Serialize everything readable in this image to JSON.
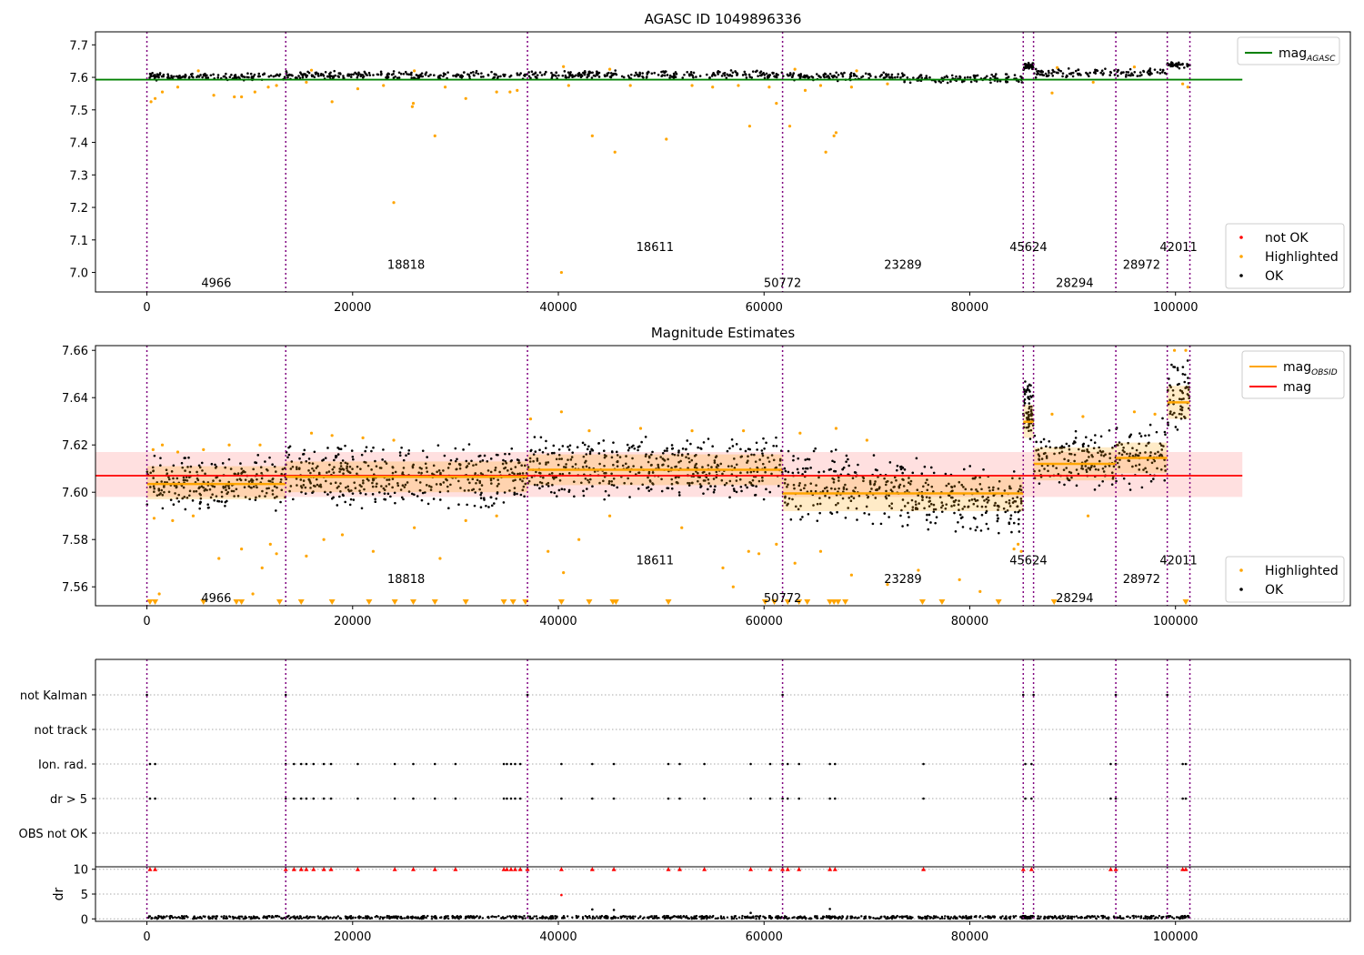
{
  "chart_data": [
    {
      "type": "scatter",
      "title": "AGASC ID 1049896336",
      "xlim": [
        -5000,
        117000
      ],
      "ylim": [
        6.94,
        7.74
      ],
      "x_ticks": [
        0,
        20000,
        40000,
        60000,
        80000,
        100000
      ],
      "y_ticks": [
        7.0,
        7.1,
        7.2,
        7.3,
        7.4,
        7.5,
        7.6,
        7.7
      ],
      "grid": false,
      "obsid_boundaries": [
        0,
        13500,
        37000,
        61800,
        85200,
        86200,
        94200,
        99200,
        101400
      ],
      "obsid_labels": [
        {
          "text": "4966",
          "x": 6750,
          "y": 6.97
        },
        {
          "text": "18818",
          "x": 25200,
          "y": 7.025
        },
        {
          "text": "18611",
          "x": 49400,
          "y": 7.08
        },
        {
          "text": "50772",
          "x": 61800,
          "y": 6.97
        },
        {
          "text": "23289",
          "x": 73500,
          "y": 7.025
        },
        {
          "text": "45624",
          "x": 85700,
          "y": 7.08
        },
        {
          "text": "28294",
          "x": 90200,
          "y": 6.97
        },
        {
          "text": "28972",
          "x": 96700,
          "y": 7.025
        },
        {
          "text": "42011",
          "x": 100300,
          "y": 7.08
        }
      ],
      "mag_agasc": 7.593,
      "mag_agasc_range": [
        -5000,
        106500
      ],
      "segments_ok": [
        {
          "x0": 0,
          "x1": 13500,
          "lo": 7.59,
          "hi": 7.615
        },
        {
          "x0": 13500,
          "x1": 37000,
          "lo": 7.592,
          "hi": 7.62
        },
        {
          "x0": 37000,
          "x1": 61800,
          "lo": 7.595,
          "hi": 7.622
        },
        {
          "x0": 61800,
          "x1": 73500,
          "lo": 7.588,
          "hi": 7.618
        },
        {
          "x0": 73500,
          "x1": 85200,
          "lo": 7.58,
          "hi": 7.612
        },
        {
          "x0": 85200,
          "x1": 86200,
          "lo": 7.62,
          "hi": 7.648
        },
        {
          "x0": 86200,
          "x1": 94200,
          "lo": 7.598,
          "hi": 7.628
        },
        {
          "x0": 94200,
          "x1": 99200,
          "lo": 7.6,
          "hi": 7.63
        },
        {
          "x0": 99200,
          "x1": 101400,
          "lo": 7.625,
          "hi": 7.65
        }
      ],
      "highlighted_points": [
        {
          "x": 400,
          "y": 7.525
        },
        {
          "x": 800,
          "y": 7.535
        },
        {
          "x": 1500,
          "y": 7.555
        },
        {
          "x": 3000,
          "y": 7.57
        },
        {
          "x": 6500,
          "y": 7.545
        },
        {
          "x": 8500,
          "y": 7.54
        },
        {
          "x": 9200,
          "y": 7.54
        },
        {
          "x": 10500,
          "y": 7.555
        },
        {
          "x": 11800,
          "y": 7.57
        },
        {
          "x": 12600,
          "y": 7.575
        },
        {
          "x": 15500,
          "y": 7.585
        },
        {
          "x": 18000,
          "y": 7.525
        },
        {
          "x": 20500,
          "y": 7.565
        },
        {
          "x": 23000,
          "y": 7.575
        },
        {
          "x": 24000,
          "y": 7.215
        },
        {
          "x": 25800,
          "y": 7.51
        },
        {
          "x": 25900,
          "y": 7.52
        },
        {
          "x": 28000,
          "y": 7.42
        },
        {
          "x": 29000,
          "y": 7.57
        },
        {
          "x": 31000,
          "y": 7.535
        },
        {
          "x": 34000,
          "y": 7.555
        },
        {
          "x": 35300,
          "y": 7.555
        },
        {
          "x": 36000,
          "y": 7.56
        },
        {
          "x": 40300,
          "y": 7.0
        },
        {
          "x": 41000,
          "y": 7.575
        },
        {
          "x": 43300,
          "y": 7.42
        },
        {
          "x": 45500,
          "y": 7.37
        },
        {
          "x": 47000,
          "y": 7.575
        },
        {
          "x": 50500,
          "y": 7.41
        },
        {
          "x": 53000,
          "y": 7.575
        },
        {
          "x": 55000,
          "y": 7.57
        },
        {
          "x": 57500,
          "y": 7.575
        },
        {
          "x": 58600,
          "y": 7.45
        },
        {
          "x": 60500,
          "y": 7.57
        },
        {
          "x": 61200,
          "y": 7.52
        },
        {
          "x": 62500,
          "y": 7.45
        },
        {
          "x": 64000,
          "y": 7.56
        },
        {
          "x": 65500,
          "y": 7.575
        },
        {
          "x": 66000,
          "y": 7.37
        },
        {
          "x": 66800,
          "y": 7.42
        },
        {
          "x": 67000,
          "y": 7.43
        },
        {
          "x": 68500,
          "y": 7.57
        },
        {
          "x": 72000,
          "y": 7.58
        },
        {
          "x": 88000,
          "y": 7.552
        },
        {
          "x": 92000,
          "y": 7.585
        },
        {
          "x": 100700,
          "y": 7.58
        },
        {
          "x": 101200,
          "y": 7.57
        },
        {
          "x": 5000,
          "y": 7.62
        },
        {
          "x": 16000,
          "y": 7.622
        },
        {
          "x": 26000,
          "y": 7.62
        },
        {
          "x": 40500,
          "y": 7.633
        },
        {
          "x": 45000,
          "y": 7.625
        },
        {
          "x": 63000,
          "y": 7.625
        },
        {
          "x": 69000,
          "y": 7.62
        },
        {
          "x": 88500,
          "y": 7.63
        },
        {
          "x": 96000,
          "y": 7.632
        }
      ],
      "legend_lines": [
        {
          "label": "mag",
          "subscript": "AGASC",
          "color": "#008000"
        }
      ],
      "legend_points": [
        {
          "label": "not OK",
          "color": "#ff0000"
        },
        {
          "label": "Highlighted",
          "color": "#ffa500"
        },
        {
          "label": "OK",
          "color": "#000000"
        }
      ]
    },
    {
      "type": "scatter",
      "title": "Magnitude Estimates",
      "xlim": [
        -5000,
        117000
      ],
      "ylim": [
        7.552,
        7.662
      ],
      "x_ticks": [
        0,
        20000,
        40000,
        60000,
        80000,
        100000
      ],
      "y_ticks": [
        7.56,
        7.58,
        7.6,
        7.62,
        7.64,
        7.66
      ],
      "grid": false,
      "obsid_boundaries": [
        0,
        13500,
        37000,
        61800,
        85200,
        86200,
        94200,
        99200,
        101400
      ],
      "obsid_labels": [
        {
          "text": "4966",
          "x": 6750,
          "y": 7.5555
        },
        {
          "text": "18818",
          "x": 25200,
          "y": 7.5635
        },
        {
          "text": "18611",
          "x": 49400,
          "y": 7.5715
        },
        {
          "text": "50772",
          "x": 61800,
          "y": 7.5555
        },
        {
          "text": "23289",
          "x": 73500,
          "y": 7.5635
        },
        {
          "text": "45624",
          "x": 85700,
          "y": 7.5715
        },
        {
          "text": "28294",
          "x": 90200,
          "y": 7.5555
        },
        {
          "text": "28972",
          "x": 96700,
          "y": 7.5635
        },
        {
          "text": "42011",
          "x": 100300,
          "y": 7.5715
        }
      ],
      "mag": 7.607,
      "mag_band": [
        7.598,
        7.617
      ],
      "mag_range": [
        -5000,
        106500
      ],
      "obsid_mags": [
        {
          "x0": 0,
          "x1": 13500,
          "mag": 7.6035,
          "lo": 7.597,
          "hi": 7.611
        },
        {
          "x0": 13500,
          "x1": 37000,
          "mag": 7.6065,
          "lo": 7.6,
          "hi": 7.613
        },
        {
          "x0": 37000,
          "x1": 61800,
          "mag": 7.6095,
          "lo": 7.603,
          "hi": 7.616
        },
        {
          "x0": 61800,
          "x1": 85200,
          "mag": 7.5995,
          "lo": 7.592,
          "hi": 7.607
        },
        {
          "x0": 85200,
          "x1": 86200,
          "mag": 7.6298,
          "lo": 7.623,
          "hi": 7.637
        },
        {
          "x0": 86200,
          "x1": 94200,
          "mag": 7.612,
          "lo": 7.605,
          "hi": 7.619
        },
        {
          "x0": 94200,
          "x1": 99200,
          "mag": 7.6145,
          "lo": 7.608,
          "hi": 7.621
        },
        {
          "x0": 99200,
          "x1": 101400,
          "mag": 7.638,
          "lo": 7.631,
          "hi": 7.645
        }
      ],
      "segments_ok": [
        {
          "x0": 0,
          "x1": 13500,
          "lo0": 7.592,
          "lo1": 7.591,
          "hi0": 7.616,
          "hi1": 7.617
        },
        {
          "x0": 13500,
          "x1": 37000,
          "lo0": 7.593,
          "lo1": 7.592,
          "hi0": 7.622,
          "hi1": 7.62
        },
        {
          "x0": 37000,
          "x1": 61800,
          "lo0": 7.595,
          "lo1": 7.596,
          "hi0": 7.624,
          "hi1": 7.624
        },
        {
          "x0": 61800,
          "x1": 85200,
          "lo0": 7.588,
          "lo1": 7.578,
          "hi0": 7.622,
          "hi1": 7.61
        },
        {
          "x0": 85200,
          "x1": 86200,
          "lo0": 7.62,
          "lo1": 7.622,
          "hi0": 7.65,
          "hi1": 7.648
        },
        {
          "x0": 86200,
          "x1": 94200,
          "lo0": 7.6,
          "lo1": 7.598,
          "hi0": 7.63,
          "hi1": 7.628
        },
        {
          "x0": 94200,
          "x1": 99200,
          "lo0": 7.6,
          "lo1": 7.6,
          "hi0": 7.63,
          "hi1": 7.632
        },
        {
          "x0": 99200,
          "x1": 101400,
          "lo0": 7.624,
          "lo1": 7.622,
          "hi0": 7.655,
          "hi1": 7.66
        }
      ],
      "highlighted_points": [
        {
          "x": 600,
          "y": 7.618
        },
        {
          "x": 1500,
          "y": 7.62
        },
        {
          "x": 3000,
          "y": 7.617
        },
        {
          "x": 5500,
          "y": 7.618
        },
        {
          "x": 8000,
          "y": 7.62
        },
        {
          "x": 11000,
          "y": 7.62
        },
        {
          "x": 700,
          "y": 7.589
        },
        {
          "x": 2500,
          "y": 7.588
        },
        {
          "x": 4500,
          "y": 7.59
        },
        {
          "x": 7000,
          "y": 7.572
        },
        {
          "x": 9200,
          "y": 7.576
        },
        {
          "x": 10300,
          "y": 7.557
        },
        {
          "x": 11200,
          "y": 7.568
        },
        {
          "x": 12000,
          "y": 7.578
        },
        {
          "x": 12600,
          "y": 7.574
        },
        {
          "x": 1200,
          "y": 7.557
        },
        {
          "x": 16000,
          "y": 7.625
        },
        {
          "x": 18000,
          "y": 7.624
        },
        {
          "x": 21000,
          "y": 7.623
        },
        {
          "x": 24000,
          "y": 7.622
        },
        {
          "x": 15500,
          "y": 7.573
        },
        {
          "x": 17200,
          "y": 7.58
        },
        {
          "x": 19000,
          "y": 7.582
        },
        {
          "x": 22000,
          "y": 7.575
        },
        {
          "x": 26000,
          "y": 7.585
        },
        {
          "x": 28500,
          "y": 7.572
        },
        {
          "x": 31000,
          "y": 7.588
        },
        {
          "x": 34000,
          "y": 7.59
        },
        {
          "x": 37300,
          "y": 7.631
        },
        {
          "x": 40300,
          "y": 7.634
        },
        {
          "x": 43000,
          "y": 7.626
        },
        {
          "x": 48000,
          "y": 7.627
        },
        {
          "x": 53000,
          "y": 7.626
        },
        {
          "x": 58000,
          "y": 7.626
        },
        {
          "x": 39000,
          "y": 7.575
        },
        {
          "x": 40500,
          "y": 7.566
        },
        {
          "x": 42000,
          "y": 7.58
        },
        {
          "x": 45000,
          "y": 7.59
        },
        {
          "x": 52000,
          "y": 7.585
        },
        {
          "x": 56000,
          "y": 7.568
        },
        {
          "x": 58500,
          "y": 7.575
        },
        {
          "x": 59500,
          "y": 7.574
        },
        {
          "x": 57000,
          "y": 7.56
        },
        {
          "x": 61200,
          "y": 7.578
        },
        {
          "x": 63500,
          "y": 7.625
        },
        {
          "x": 67000,
          "y": 7.627
        },
        {
          "x": 70000,
          "y": 7.622
        },
        {
          "x": 63000,
          "y": 7.57
        },
        {
          "x": 65500,
          "y": 7.575
        },
        {
          "x": 68500,
          "y": 7.565
        },
        {
          "x": 72000,
          "y": 7.561
        },
        {
          "x": 75000,
          "y": 7.567
        },
        {
          "x": 79000,
          "y": 7.563
        },
        {
          "x": 81000,
          "y": 7.558
        },
        {
          "x": 84300,
          "y": 7.576
        },
        {
          "x": 85000,
          "y": 7.575
        },
        {
          "x": 84700,
          "y": 7.578
        },
        {
          "x": 88000,
          "y": 7.633
        },
        {
          "x": 91000,
          "y": 7.632
        },
        {
          "x": 96000,
          "y": 7.634
        },
        {
          "x": 98000,
          "y": 7.633
        },
        {
          "x": 91500,
          "y": 7.59
        },
        {
          "x": 99900,
          "y": 7.66
        },
        {
          "x": 101000,
          "y": 7.66
        }
      ],
      "clipped_markers_x": [
        300,
        800,
        5500,
        8700,
        9200,
        12900,
        15000,
        18000,
        21600,
        24100,
        25900,
        28000,
        31000,
        34700,
        35600,
        36800,
        40300,
        43000,
        45300,
        45600,
        50700,
        60100,
        61000,
        62300,
        63400,
        64200,
        66400,
        66800,
        67200,
        67900,
        75400,
        77300,
        82800,
        88200,
        101000
      ],
      "legend_lines": [
        {
          "label": "mag",
          "subscript": "OBSID",
          "color": "#ffa500"
        },
        {
          "label": "mag",
          "subscript": "",
          "color": "#ff0000"
        }
      ],
      "legend_points": [
        {
          "label": "Highlighted",
          "color": "#ffa500"
        },
        {
          "label": "OK",
          "color": "#000000"
        }
      ]
    },
    {
      "type": "scatter",
      "title": "",
      "xlim": [
        -5000,
        117000
      ],
      "flag_labels": [
        "not Kalman",
        "not track",
        "Ion. rad.",
        "dr > 5",
        "OBS not OK"
      ],
      "flag_points": {
        "not Kalman": [
          0,
          13500,
          37000,
          61800,
          85200,
          86200,
          94200,
          99200
        ],
        "not track": [],
        "Ion. rad.": [
          300,
          800,
          13500,
          14300,
          15000,
          15500,
          16200,
          17200,
          17900,
          20500,
          24100,
          25900,
          28000,
          30000,
          34700,
          35000,
          35400,
          35800,
          36300,
          40300,
          43300,
          45400,
          50700,
          51800,
          54200,
          58700,
          60600,
          61800,
          62300,
          63400,
          66400,
          66900,
          75500,
          85400,
          86000,
          93700,
          94200,
          100700,
          101000
        ],
        "dr > 5": [
          300,
          800,
          13500,
          14300,
          15000,
          15500,
          16200,
          17200,
          17900,
          20500,
          24100,
          25900,
          28000,
          30000,
          34700,
          35000,
          35400,
          35800,
          36300,
          40300,
          43300,
          45400,
          50700,
          51800,
          54200,
          58700,
          60600,
          61800,
          62300,
          63400,
          66400,
          66900,
          75500,
          85400,
          86000,
          93700,
          94200,
          100700,
          101000
        ],
        "OBS not OK": []
      },
      "dr_ylabel": "dr",
      "dr_ylim": [
        -0.5,
        10.5
      ],
      "dr_y_ticks": [
        0,
        5,
        10
      ],
      "dr_points_high": [
        300,
        800,
        13500,
        14300,
        15000,
        15500,
        16200,
        17200,
        17900,
        20500,
        24100,
        25900,
        28000,
        30000,
        34700,
        35000,
        35400,
        35800,
        36300,
        37000,
        40300,
        43300,
        45400,
        50700,
        51800,
        54200,
        58700,
        60600,
        61800,
        62300,
        63400,
        66400,
        66900,
        75500,
        85200,
        86000,
        93700,
        94200,
        100700,
        101000
      ],
      "dr_points_mid": [
        {
          "x": 40300,
          "y": 4.8
        },
        {
          "x": 43300,
          "y": 1.9
        },
        {
          "x": 45400,
          "y": 1.8
        },
        {
          "x": 58700,
          "y": 1.2
        },
        {
          "x": 66400,
          "y": 2.0
        }
      ],
      "x_ticks": [
        0,
        20000,
        40000,
        60000,
        80000,
        100000
      ]
    }
  ]
}
